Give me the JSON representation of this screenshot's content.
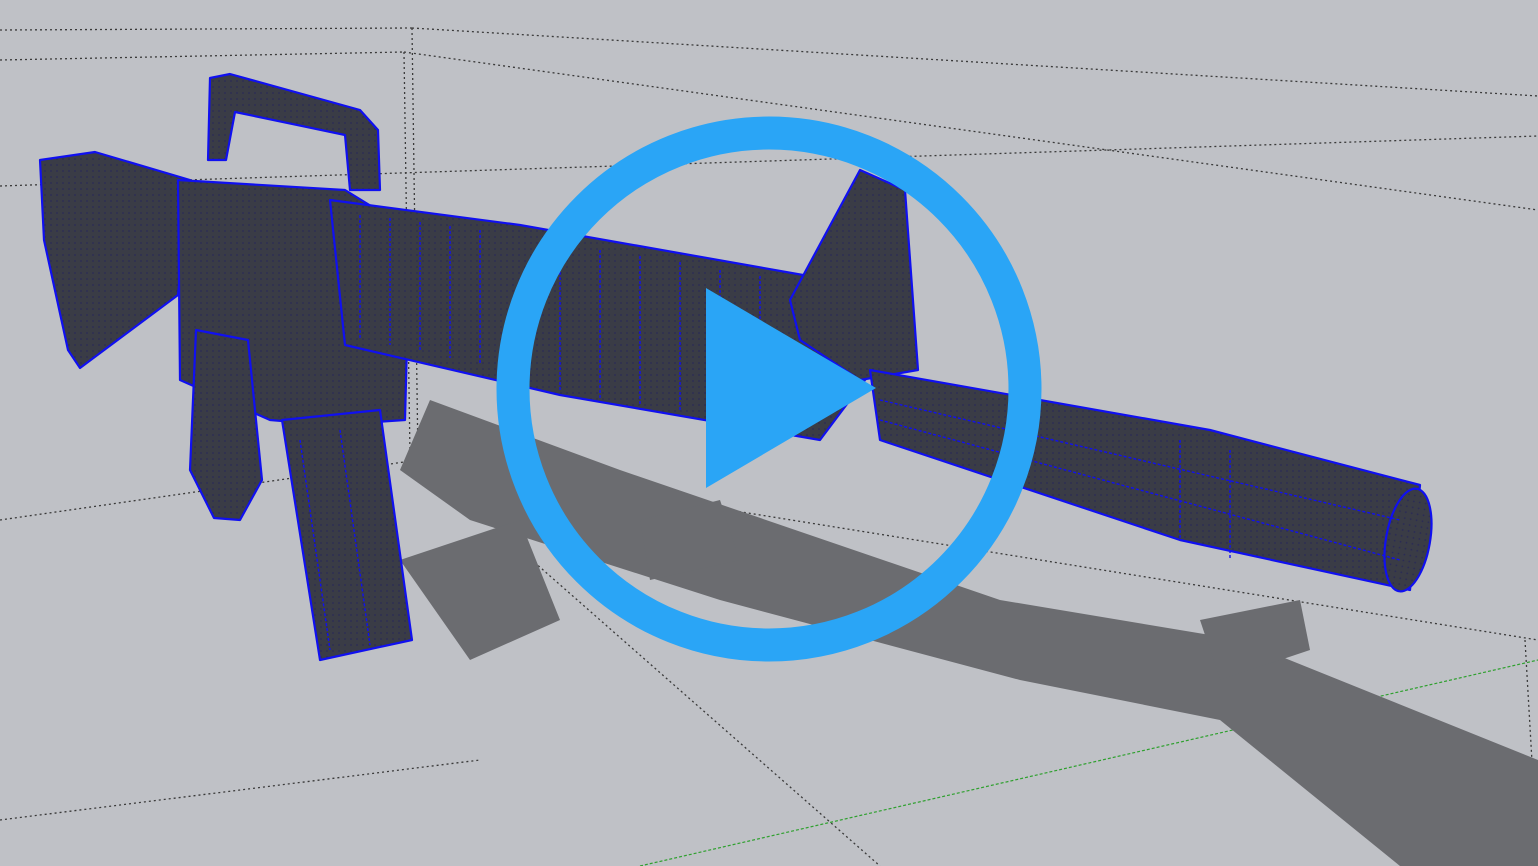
{
  "viewport": {
    "kind": "3d-modeling-viewport",
    "render_mode": "shaded-with-wireframe",
    "background_color": "#bfc1c6",
    "model_color": "#3a3c46",
    "wireframe_color": "#1010f0",
    "shadow_color": "#6b6c70",
    "grid_color": "#3a3a3a",
    "axis_color": "#2ea02e"
  },
  "play_button": {
    "icon": "play-icon",
    "color": "#2aa5f6"
  }
}
